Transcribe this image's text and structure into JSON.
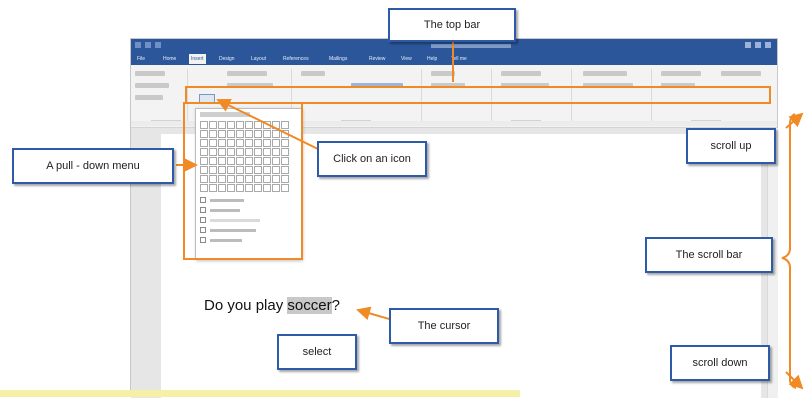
{
  "word_window": {
    "tabs": [
      "File",
      "Home",
      "Insert",
      "Design",
      "Layout",
      "References",
      "Mailings",
      "Review",
      "View",
      "Help",
      "Tell me"
    ],
    "active_tab": "Insert"
  },
  "document": {
    "text_before": "Do you play ",
    "selected_word": "soccer",
    "text_after": "?"
  },
  "callouts": {
    "top_bar": "The top bar",
    "pull_down_menu": "A pull - down menu",
    "click_icon": "Click on an icon",
    "scroll_up": "scroll up",
    "scroll_bar": "The scroll bar",
    "cursor": "The cursor",
    "select": "select",
    "scroll_down": "scroll down"
  },
  "colors": {
    "callout_border": "#2e5aa8",
    "arrow": "#f08a24",
    "word_blue": "#2b579a",
    "highlight": "#f5f0a8"
  }
}
